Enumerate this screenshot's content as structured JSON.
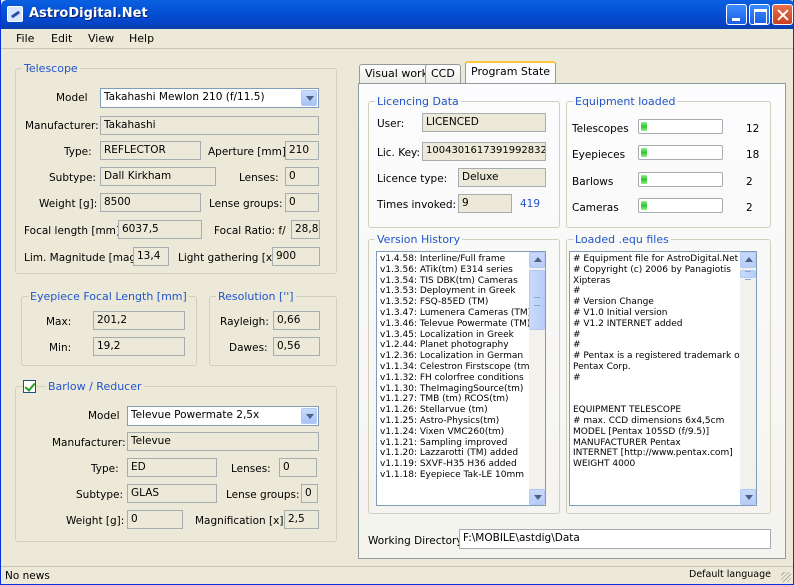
{
  "window": {
    "title": "AstroDigital.Net"
  },
  "menu": [
    "File",
    "Edit",
    "View",
    "Help"
  ],
  "telescope": {
    "group_label": "Telescope",
    "model_label": "Model",
    "model": "Takahashi Mewlon 210 (f/11.5)",
    "manufacturer_label": "Manufacturer:",
    "manufacturer": "Takahashi",
    "type_label": "Type:",
    "type": "REFLECTOR",
    "aperture_label": "Aperture [mm]:",
    "aperture": "210",
    "subtype_label": "Subtype:",
    "subtype": "Dall Kirkham",
    "lenses_label": "Lenses:",
    "lenses": "0",
    "weight_label": "Weight [g]:",
    "weight": "8500",
    "lense_groups_label": "Lense groups:",
    "lense_groups": "0",
    "focal_length_label": "Focal length [mm]:",
    "focal_length": "6037,5",
    "focal_ratio_label": "Focal Ratio:  f/",
    "focal_ratio": "28,8",
    "lim_mag_label": "Lim. Magnitude [mag]:",
    "lim_mag": "13,4",
    "light_gathering_label": "Light gathering [x]:",
    "light_gathering": "900"
  },
  "eyepiece": {
    "group_label": "Eyepiece Focal Length [mm]",
    "max_label": "Max:",
    "max": "201,2",
    "min_label": "Min:",
    "min": "19,2"
  },
  "resolution": {
    "group_label": "Resolution ['']",
    "rayleigh_label": "Rayleigh:",
    "rayleigh": "0,66",
    "dawes_label": "Dawes:",
    "dawes": "0,56"
  },
  "barlow": {
    "group_label": "Barlow / Reducer",
    "checked": true,
    "model_label": "Model",
    "model": "Televue Powermate 2,5x",
    "manufacturer_label": "Manufacturer:",
    "manufacturer": "Televue",
    "type_label": "Type:",
    "type": "ED",
    "lenses_label": "Lenses:",
    "lenses": "0",
    "subtype_label": "Subtype:",
    "subtype": "GLAS",
    "lense_groups_label": "Lense groups:",
    "lense_groups": "0",
    "weight_label": "Weight [g]:",
    "weight": "0",
    "magnification_label": "Magnification [x]:",
    "magnification": "2,5"
  },
  "tabs": [
    {
      "label": "Visual work",
      "active": false
    },
    {
      "label": "CCD",
      "active": false
    },
    {
      "label": "Program State",
      "active": true
    }
  ],
  "licencing": {
    "group_label": "Licencing Data",
    "user_label": "User:",
    "user": "LICENCED",
    "key_label": "Lic. Key:",
    "key": "1004301617391992832",
    "type_label": "Licence type:",
    "type": "Deluxe",
    "times_label": "Times invoked:",
    "times": "9",
    "times_extra": "419"
  },
  "equipment": {
    "group_label": "Equipment loaded",
    "items": [
      {
        "label": "Telescopes",
        "count": "12",
        "level": 0.08
      },
      {
        "label": "Eyepieces",
        "count": "18",
        "level": 0.08
      },
      {
        "label": "Barlows",
        "count": "2",
        "level": 0.08
      },
      {
        "label": "Cameras",
        "count": "2",
        "level": 0.08
      }
    ]
  },
  "version_history": {
    "group_label": "Version History",
    "items": [
      "v1.4.58: Interline/Full frame",
      "v1.3.56: ATik(tm) E314 series",
      "v1.3.54: TIS DBK(tm) Cameras",
      "v1.3.53: Deployment in Greek",
      "v1.3.52: FSQ-85ED (TM)",
      "v1.3.47: Lumenera Cameras (TM)",
      "v1.3.46: Televue Powermate (TM)",
      "v1.3.45: Localization in Greek",
      "v1.2.44: Planet photography",
      "v1.2.36: Localization in German",
      "v1.1.34: Celestron Firstscope (tm)",
      "v1.1.32: FH colorfree conditions",
      "v1.1.30: TheImagingSource(tm)",
      "v1.1.27: TMB (tm) RCOS(tm)",
      "v1.1.26: Stellarvue (tm)",
      "v1.1.25: Astro-Physics(tm)",
      "v1.1.24: Vixen VMC260(tm)",
      "v1.1.21: Sampling improved",
      "v1.1.20: Lazzarotti (TM) added",
      "v1.1.19: SXVF-H35 H36 added",
      "v1.1.18: Eyepiece Tak-LE 10mm"
    ]
  },
  "equ_files": {
    "group_label": "Loaded .equ files",
    "lines": [
      "# Equipment file for AstroDigital.Net",
      "# Copyright (c) 2006 by Panagiotis",
      "Xipteras",
      "#",
      "# Version    Change",
      "# V1.0       Initial version",
      "# V1.2       INTERNET added",
      "#",
      "#",
      "# Pentax is a registered trademark of",
      "Pentax Corp.",
      "#",
      "",
      "",
      "EQUIPMENT TELESCOPE",
      "# max. CCD dimensions 6x4,5cm",
      "MODEL [Pentax 105SD (f/9.5)]",
      "MANUFACTURER Pentax",
      "INTERNET [http://www.pentax.com]",
      "WEIGHT 4000"
    ]
  },
  "working_dir": {
    "label": "Working Directory:",
    "value": "F:\\MOBILE\\astdig\\Data"
  },
  "status": {
    "left": "No news",
    "right": "Default language"
  }
}
